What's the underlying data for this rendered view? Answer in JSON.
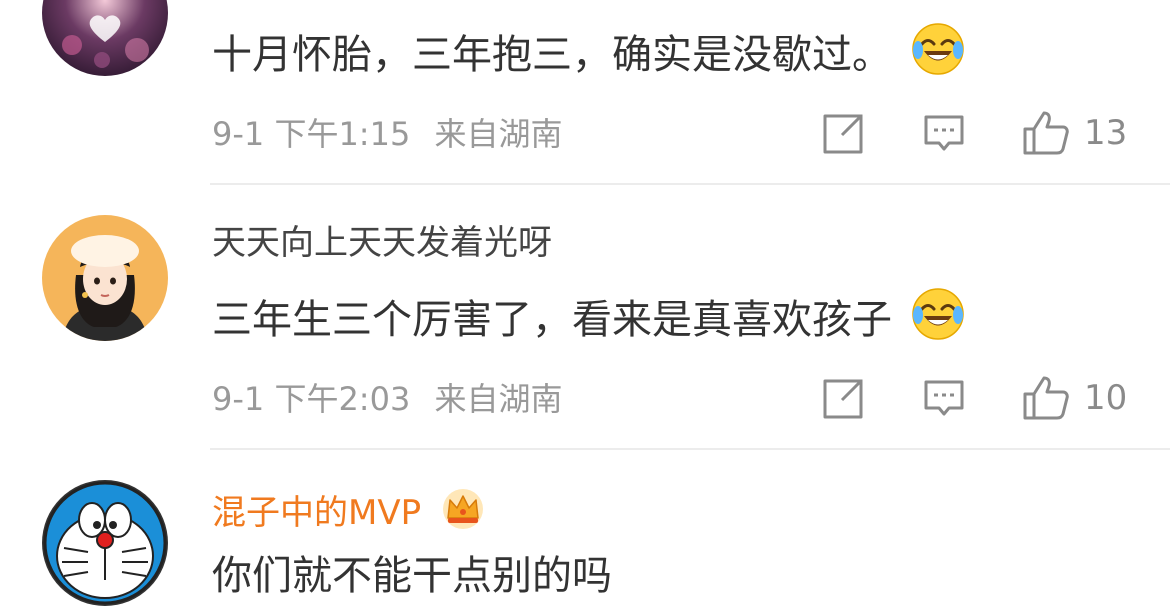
{
  "comments": [
    {
      "username": "",
      "text": "十月怀胎，三年抱三，确实是没歇过。",
      "emoji": "laughing-tears-emoji",
      "time": "9-1 下午1:15",
      "location": "来自湖南",
      "likes": "13"
    },
    {
      "username": "天天向上天天发着光呀",
      "text": "三年生三个厉害了，看来是真喜欢孩子",
      "emoji": "laughing-tears-emoji",
      "time": "9-1 下午2:03",
      "location": "来自湖南",
      "likes": "10"
    },
    {
      "username": "混子中的MVP",
      "badge": "crown-icon",
      "text": "你们就不能干点别的吗",
      "time": "",
      "location": "",
      "likes": ""
    }
  ],
  "colors": {
    "vip_name": "#f07a1f",
    "meta_text": "#999999",
    "icon": "#8a8a8a",
    "divider": "#ececec"
  }
}
